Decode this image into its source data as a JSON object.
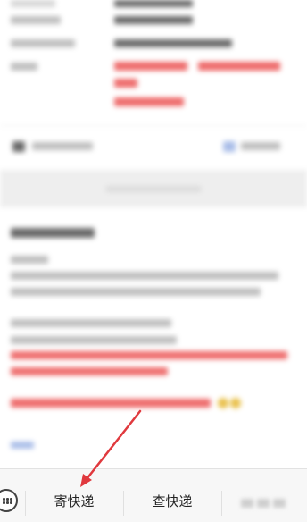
{
  "bottom_menu": {
    "items": [
      {
        "label": "寄快递"
      },
      {
        "label": "查快递"
      }
    ]
  },
  "icons": {
    "keyboard": "keyboard-icon",
    "annotation": "red-arrow-annotation"
  },
  "colors": {
    "annotation_red": "#e0393e",
    "highlight_text_red": "#ee6b6b",
    "menu_background": "#f7f7f7"
  }
}
